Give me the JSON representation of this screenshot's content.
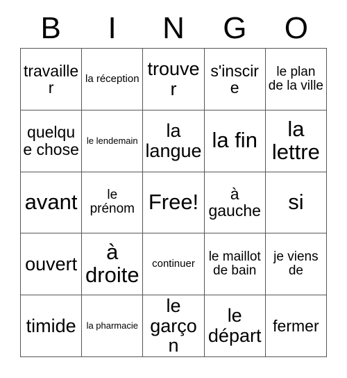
{
  "card": {
    "title_letters": [
      "B",
      "I",
      "N",
      "G",
      "O"
    ],
    "rows": [
      [
        {
          "text": "travailler",
          "size": "s-md"
        },
        {
          "text": "la réception",
          "size": "s-xs"
        },
        {
          "text": "trouver",
          "size": "s-lg"
        },
        {
          "text": "s'inscire",
          "size": "s-md"
        },
        {
          "text": "le plan de la ville",
          "size": "s-sm"
        }
      ],
      [
        {
          "text": "quelque chose",
          "size": "s-md"
        },
        {
          "text": "le lendemain",
          "size": "s-xxs"
        },
        {
          "text": "la langue",
          "size": "s-lg"
        },
        {
          "text": "la fin",
          "size": "s-xl"
        },
        {
          "text": "la lettre",
          "size": "s-xl"
        }
      ],
      [
        {
          "text": "avant",
          "size": "s-xl"
        },
        {
          "text": "le prénom",
          "size": "s-sm"
        },
        {
          "text": "Free!",
          "size": "s-xl"
        },
        {
          "text": "à gauche",
          "size": "s-md"
        },
        {
          "text": "si",
          "size": "s-xl"
        }
      ],
      [
        {
          "text": "ouvert",
          "size": "s-lg"
        },
        {
          "text": "à droite",
          "size": "s-xl"
        },
        {
          "text": "continuer",
          "size": "s-xs"
        },
        {
          "text": "le maillot de bain",
          "size": "s-sm"
        },
        {
          "text": "je viens de",
          "size": "s-sm"
        }
      ],
      [
        {
          "text": "timide",
          "size": "s-lg"
        },
        {
          "text": "la pharmacie",
          "size": "s-xxs"
        },
        {
          "text": "le garçon",
          "size": "s-lg"
        },
        {
          "text": "le départ",
          "size": "s-lg"
        },
        {
          "text": "fermer",
          "size": "s-md"
        }
      ]
    ],
    "colors": {
      "background": "#ffffff",
      "text": "#000000",
      "grid_line": "#555555"
    }
  }
}
